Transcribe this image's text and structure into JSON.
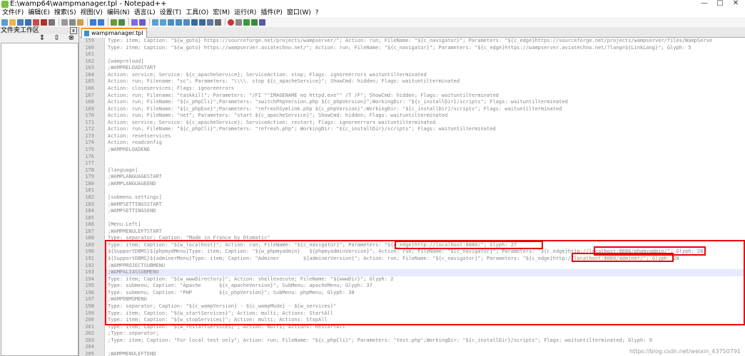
{
  "window": {
    "title": "E:\\wamp64\\wampmanager.tpl - Notepad++",
    "controls": [
      "—",
      "□",
      "✕"
    ]
  },
  "menu": [
    "文件(F)",
    "编辑(E)",
    "搜索(S)",
    "视图(V)",
    "编码(N)",
    "语言(L)",
    "设置(T)",
    "工具(O)",
    "宏(M)",
    "运行(R)",
    "插件(P)",
    "窗口(W)",
    "?"
  ],
  "panel": {
    "title": "文件夹工作区",
    "close": "x"
  },
  "tab": {
    "label": "wampmanager.tpl"
  },
  "editor": {
    "lines": [
      {
        "n": "159",
        "t": "Type: item; Caption: \"${w_goto} https://sourceforge.net/projects/wampserver/\"; Action: run; FileName: \"${c_navigator}\"; Parameters: \"${c_edge}https://sourceforge.net/projects/wampserver/files/WampServe"
      },
      {
        "n": "160",
        "t": "Type: item; Caption: \"${w_goto} https://wampserver.aviatechno.net/\"; Action: run; FileName: \"${c_navigator}\"; Parameters: \"${c_edge}https://wampserver.aviatechno.net/?lang=${LinkLang}\"; Glyph: 5"
      },
      {
        "n": "161",
        "t": ""
      },
      {
        "n": "162",
        "t": "[wampreload]"
      },
      {
        "n": "163",
        "t": ";WAMPRELOADSTART"
      },
      {
        "n": "164",
        "t": "Action: service; Service: ${c_apacheService}; ServiceAction: stop; Flags: ignoreerrors waituntilterminated"
      },
      {
        "n": "165",
        "t": "Action: run; Filename: \"sc\"; Parameters: \"\\\\\\\\. stop ${c_apacheService}\"; ShowCmd: hidden; Flags: waituntilterminated"
      },
      {
        "n": "166",
        "t": "Action: closeservices; Flags: ignoreerrors"
      },
      {
        "n": "167",
        "t": "Action: run; Filename: \"taskkill\"; Parameters: \"/FI \"\"IMAGENAME eq httpd.exe\"\" /T /F\"; ShowCmd: hidden; Flags: waituntilterminated"
      },
      {
        "n": "168",
        "t": "Action: run; FileName: \"${c_phpCli}\";Parameters: \"switchPhpVersion.php ${c_phpVersion}\";WorkingDir: \"${c_installDir}/scripts\"; Flags: waituntilterminated"
      },
      {
        "n": "169",
        "t": "Action: run; FileName: \"${c_phpExe}\";Parameters: \"refreshSymlink.php ${c_phpVersion}\";WorkingDir: \"${c_installDir}/scripts\"; Flags: waituntilterminated"
      },
      {
        "n": "170",
        "t": "Action: run; FileName: \"net\"; Parameters: \"start ${c_apacheService}\"; ShowCmd: hidden; Flags: waituntilterminated"
      },
      {
        "n": "171",
        "t": "Action: service; Service: ${c_apacheService}; ServiceAction: restart; Flags: ignoreerrors waituntilterminated"
      },
      {
        "n": "172",
        "t": "Action: run; FileName: \"${c_phpCli}\";Parameters: \"refresh.php\"; WorkingDir: \"${c_installDir}/scripts\"; Flags: waituntilterminated"
      },
      {
        "n": "173",
        "t": "Action: resetservices"
      },
      {
        "n": "174",
        "t": "Action: readconfig"
      },
      {
        "n": "175",
        "t": ";WAMPRELOADEND"
      },
      {
        "n": "176",
        "t": ""
      },
      {
        "n": "177",
        "t": ""
      },
      {
        "n": "178",
        "t": "[language]"
      },
      {
        "n": "179",
        "t": ";WAMPLANGUAGESTART"
      },
      {
        "n": "180",
        "t": ";WAMPLANGUAGEEND"
      },
      {
        "n": "181",
        "t": ""
      },
      {
        "n": "182",
        "t": "[submenu.settings]"
      },
      {
        "n": "183",
        "t": ";WAMPSETTINGSSTART"
      },
      {
        "n": "184",
        "t": ";WAMPSETTINGSEND"
      },
      {
        "n": "185",
        "t": ""
      },
      {
        "n": "186",
        "t": "[Menu.Left]"
      },
      {
        "n": "187",
        "t": ";WAMPMENULEFTSTART"
      },
      {
        "n": "188",
        "t": "Type: separator; Caption: \"Made in France by Otomatic\""
      },
      {
        "n": "189",
        "t": "Type: item; Caption: \"${w_localhost}\"; Action: run; FileName: \"${c_navigator}\"; Parameters: \"${c_edge}http://localhost:8080/\"; Glyph: 27"
      },
      {
        "n": "190",
        "t": "${SupportDBMS}${phpmydMenu}Type: item; Caption: \"${w_phpmyadmin}   ${phpmyadminVersion}\"; Action: run; FileName: \"${c_navigator}\"; Parameters: \"${c_edge}http://localhost:8080/phpmyadmin/\"; Glyph: 28"
      },
      {
        "n": "191",
        "t": "${SupportDBMS}${adminerMenu}Type: item; Caption: \"Adminer        ${adminerVersion}\"; Action: run; FileName: \"${c_navigator}\"; Parameters: \"${c_edge}http://localhost:8080/adminer/\"; Glyph: 28"
      },
      {
        "n": "192",
        "t": ";WAMPPROJECTSUBMENU"
      },
      {
        "n": "193",
        "t": ";WAMPALIASSUBMENU"
      },
      {
        "n": "194",
        "t": "Type: item; Caption: \"${w_wwwDirectory}\"; Action: shellexecute; FileName: \"${wwwDir}\"; Glyph: 2"
      },
      {
        "n": "195",
        "t": "Type: submenu; Caption: \"Apache      ${c_apacheVersion}\"; SubMenu: apacheMenu; Glyph: 37"
      },
      {
        "n": "196",
        "t": "Type: submenu; Caption: \"PHP         ${c_phpVersion}\"; SubMenu: phpMenu; Glyph: 38"
      },
      {
        "n": "197",
        "t": ";WAMPDBMSMENU"
      },
      {
        "n": "198",
        "t": "Type: separator; Caption: \"${c_wampVersion} - ${c_wampMode} - ${w_services}\""
      },
      {
        "n": "199",
        "t": "Type: item; Caption: \"${w_startServices}\"; Action: multi; Actions: StartAll"
      },
      {
        "n": "200",
        "t": "Type: item; Caption: \"${w_stopServices}\"; Action: multi; Actions: StopAll"
      },
      {
        "n": "201",
        "t": "Type: item; Caption: \"${w_restartServices}\"; Action: multi; Actions: RestartAll"
      },
      {
        "n": "202",
        "t": ";Type: separator;"
      },
      {
        "n": "203",
        "t": ";Type: item; Caption: \"For local test only\"; Action: run; FileName: \"${c_phpCli}\"; Parameters: \"test.php\";WorkingDir: \"${c_installDir}/scripts\"; Flags: waituntilterminated; Glyph: 9"
      },
      {
        "n": "204",
        "t": ""
      },
      {
        "n": "205",
        "t": ";WAMPMENULEFTEND"
      }
    ]
  },
  "watermark": "https://blog.csdn.net/weixin_43750791"
}
